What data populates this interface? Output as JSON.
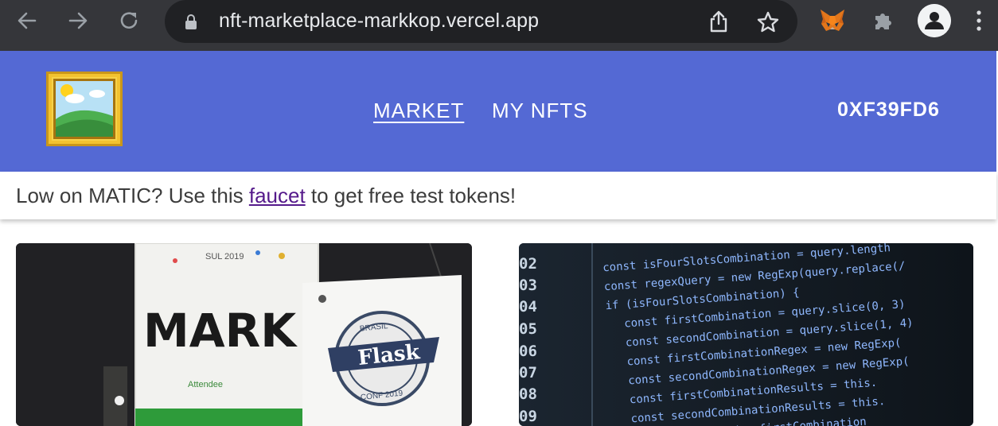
{
  "browser": {
    "url": "nft-marketplace-markkop.vercel.app",
    "icons": [
      "back-arrow-icon",
      "forward-arrow-icon",
      "reload-icon",
      "lock-icon",
      "share-icon",
      "star-icon",
      "metamask-fox-icon",
      "puzzle-extension-icon",
      "profile-icon",
      "kebab-menu-icon"
    ]
  },
  "header": {
    "logo_icon": "framed-picture-icon",
    "nav": [
      {
        "label": "MARKET",
        "active": true
      },
      {
        "label": "MY NFTS",
        "active": false
      }
    ],
    "account": "0XF39FD6",
    "background_color": "#5469d4"
  },
  "banner": {
    "text_before": "Low on MATIC? Use this ",
    "link_text": "faucet",
    "text_after": " to get free test tokens!"
  },
  "cards": [
    {
      "image_text": {
        "badge_name": "MARK",
        "badge_role": "Attendee",
        "badge_event": "SUL 2019",
        "seal_title": "Flask",
        "seal_top": "BRASIL",
        "seal_bottom": "CONF 2019"
      }
    },
    {
      "image_text": {
        "line_numbers": [
          "02",
          "03",
          "04",
          "05",
          "06",
          "07",
          "08",
          "09"
        ],
        "code_lines": [
          "const isFourSlotsCombination = query.length",
          "const regexQuery = new RegExp(query.replace(/",
          "if (isFourSlotsCombination) {",
          "const firstCombination = query.slice(0, 3)",
          "const secondCombination = query.slice(1, 4)",
          "const firstCombinationRegex = new RegExp(",
          "const secondCombinationRegex = new RegExp(",
          "const firstCombinationResults = this.",
          "const secondCombinationResults = this.",
          "const isRepeated = firstCombination"
        ]
      }
    }
  ]
}
